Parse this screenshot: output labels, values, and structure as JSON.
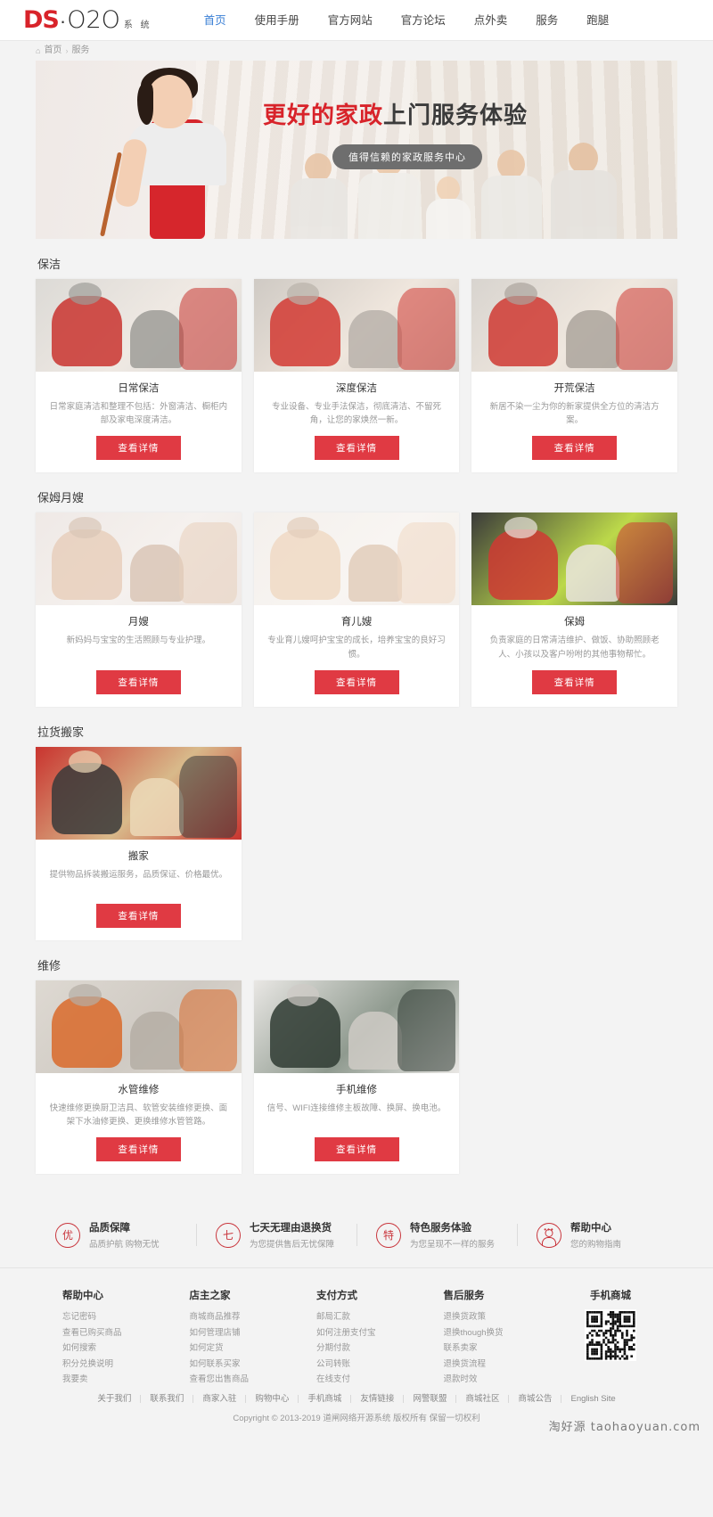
{
  "header": {
    "logo": {
      "ds": "DS",
      "dot": "·",
      "o2o": "O2O",
      "sys": "系 统"
    },
    "nav": [
      {
        "label": "首页",
        "active": true
      },
      {
        "label": "使用手册",
        "active": false
      },
      {
        "label": "官方网站",
        "active": false
      },
      {
        "label": "官方论坛",
        "active": false
      },
      {
        "label": "点外卖",
        "active": false
      },
      {
        "label": "服务",
        "active": false
      },
      {
        "label": "跑腿",
        "active": false
      }
    ]
  },
  "breadcrumb": {
    "home_icon": "home-icon",
    "home": "首页",
    "separator": "›",
    "current": "服务"
  },
  "banner": {
    "title_red": "更好的家政",
    "title_dark": "上门服务体验",
    "pill": "值得信赖的家政服务中心"
  },
  "sections": [
    {
      "title": "保洁",
      "cards": [
        {
          "name": "日常保洁",
          "desc": "日常家庭清洁和整理不包括：外窗清洁、橱柜内部及家电深度清洁。",
          "button": "查看详情"
        },
        {
          "name": "深度保洁",
          "desc": "专业设备、专业手法保洁，彻底清洁、不留死角，让您的家焕然一新。",
          "button": "查看详情"
        },
        {
          "name": "开荒保洁",
          "desc": "新居不染一尘为你的新家提供全方位的清洁方案。",
          "button": "查看详情"
        }
      ]
    },
    {
      "title": "保姆月嫂",
      "cards": [
        {
          "name": "月嫂",
          "desc": "新妈妈与宝宝的生活照顾与专业护理。",
          "button": "查看详情"
        },
        {
          "name": "育儿嫂",
          "desc": "专业育儿嫂呵护宝宝的成长，培养宝宝的良好习惯。",
          "button": "查看详情"
        },
        {
          "name": "保姆",
          "desc": "负责家庭的日常清洁维护、做饭、协助照顾老人、小孩以及客户吩咐的其他事物帮忙。",
          "button": "查看详情"
        }
      ]
    },
    {
      "title": "拉货搬家",
      "cards": [
        {
          "name": "搬家",
          "desc": "提供物品拆装搬运服务，品质保证、价格最优。",
          "button": "查看详情"
        }
      ]
    },
    {
      "title": "维修",
      "cards": [
        {
          "name": "水管维修",
          "desc": "快速维修更换厨卫洁具、软管安装维修更换、面架下水油修更换、更换维修水管管路。",
          "button": "查看详情"
        },
        {
          "name": "手机维修",
          "desc": "信号、WIFI连接维修主板故障、换屏、换电池。",
          "button": "查看详情"
        }
      ]
    }
  ],
  "trust": [
    {
      "icon_char": "优",
      "title": "品质保障",
      "subtitle": "品质护航 购物无忧"
    },
    {
      "icon_char": "七",
      "title": "七天无理由退换货",
      "subtitle": "为您提供售后无忧保障"
    },
    {
      "icon_char": "特",
      "title": "特色服务体验",
      "subtitle": "为您呈现不一样的服务"
    },
    {
      "icon_char": "",
      "title": "帮助中心",
      "subtitle": "您的购物指南"
    }
  ],
  "footer": {
    "columns": [
      {
        "title": "帮助中心",
        "links": [
          "忘记密码",
          "查看已购买商品",
          "如何搜索",
          "积分兑换说明",
          "我要卖"
        ]
      },
      {
        "title": "店主之家",
        "links": [
          "商城商品推荐",
          "如何管理店铺",
          "如何定货",
          "如何联系买家",
          "查看您出售商品"
        ]
      },
      {
        "title": "支付方式",
        "links": [
          "邮局汇款",
          "如何注册支付宝",
          "分期付款",
          "公司转账",
          "在线支付"
        ]
      },
      {
        "title": "售后服务",
        "links": [
          "退换货政策",
          "退换though换货",
          "联系卖家",
          "退换货流程",
          "退款时效"
        ]
      }
    ],
    "qr": {
      "title": "手机商城"
    },
    "bottom_links": [
      "关于我们",
      "联系我们",
      "商家入驻",
      "购物中心",
      "手机商城",
      "友情链接",
      "网警联盟",
      "商城社区",
      "商城公告",
      "English Site"
    ],
    "copyright": "Copyright © 2013-2019 道闸网络开源系统 版权所有 保留一切权利",
    "watermark": "淘好源 taohaoyuan.com"
  }
}
